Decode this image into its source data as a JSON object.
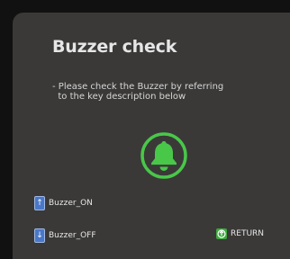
{
  "screen": {
    "title": "Buzzer check",
    "description": [
      "- Please check the Buzzer by referring",
      "  to the key description below"
    ]
  },
  "icons": {
    "bell": "bell-icon",
    "up": "arrow-up-key-icon",
    "down": "arrow-down-key-icon",
    "return": "return-icon"
  },
  "colors": {
    "background": "#3a3938",
    "accent_green": "#49c749",
    "key_blue": "#4a78c8"
  },
  "keys": {
    "buzzer_on": "Buzzer_ON",
    "buzzer_off": "Buzzer_OFF",
    "return": "RETURN"
  }
}
